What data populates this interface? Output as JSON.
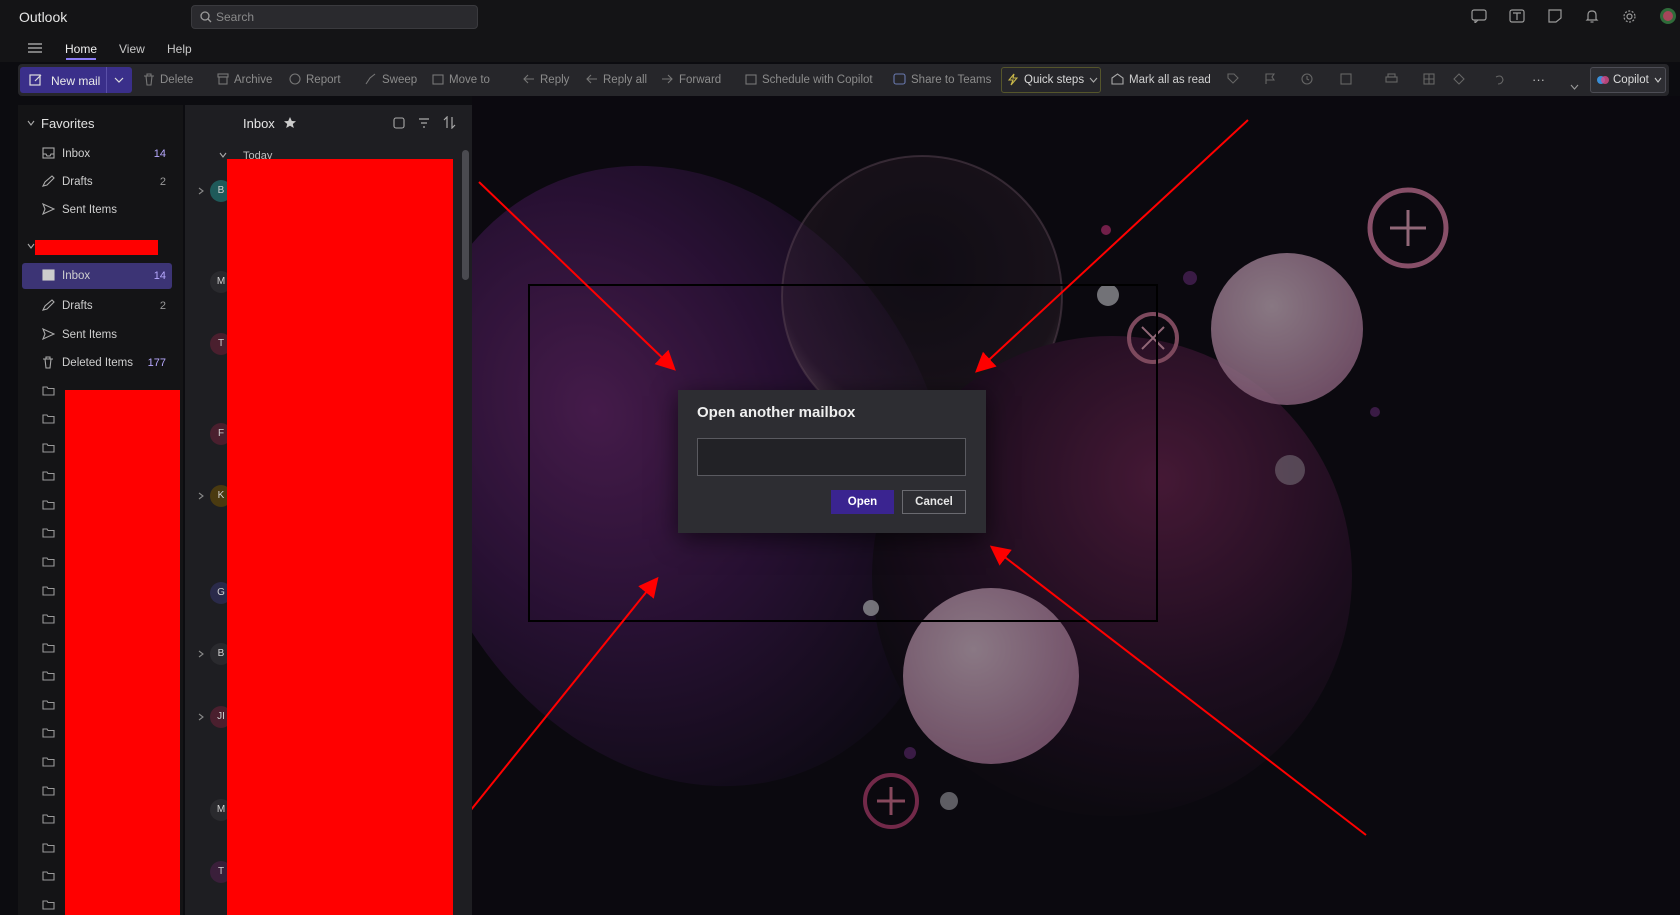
{
  "app": {
    "title": "Outlook"
  },
  "search": {
    "placeholder": "Search"
  },
  "menu": {
    "tabs": [
      "Home",
      "View",
      "Help"
    ],
    "active": "Home"
  },
  "ribbon": {
    "new_mail": "New mail",
    "delete": "Delete",
    "archive": "Archive",
    "report": "Report",
    "sweep": "Sweep",
    "move_to": "Move to",
    "reply": "Reply",
    "reply_all": "Reply all",
    "forward": "Forward",
    "schedule": "Schedule with Copilot",
    "share": "Share to Teams",
    "quick_steps": "Quick steps",
    "mark_all_read": "Mark all as read",
    "more": "···",
    "copilot": "Copilot"
  },
  "folders": {
    "favorites_header": "Favorites",
    "favorites": [
      {
        "label": "Inbox",
        "count": "14",
        "icon": "inbox-icon"
      },
      {
        "label": "Drafts",
        "count": "2",
        "icon": "drafts-icon"
      },
      {
        "label": "Sent Items",
        "count": "",
        "icon": "sent-icon"
      }
    ],
    "account": [
      {
        "label": "Inbox",
        "count": "14",
        "icon": "inbox-icon",
        "selected": true
      },
      {
        "label": "Drafts",
        "count": "2",
        "icon": "drafts-icon"
      },
      {
        "label": "Sent Items",
        "count": "",
        "icon": "sent-icon"
      },
      {
        "label": "Deleted Items",
        "count": "177",
        "icon": "trash-icon"
      }
    ]
  },
  "message_list": {
    "title": "Inbox",
    "group": "Today",
    "avatar_initials": [
      "B",
      "M",
      "T",
      "F",
      "K",
      "G",
      "B",
      "JI",
      "M",
      "T"
    ]
  },
  "dialog": {
    "title": "Open another mailbox",
    "input_value": "",
    "open_label": "Open",
    "cancel_label": "Cancel"
  },
  "colors": {
    "accent": "#3a2490",
    "selected_folder": "#3c3475",
    "annotation": "#ff0000"
  }
}
